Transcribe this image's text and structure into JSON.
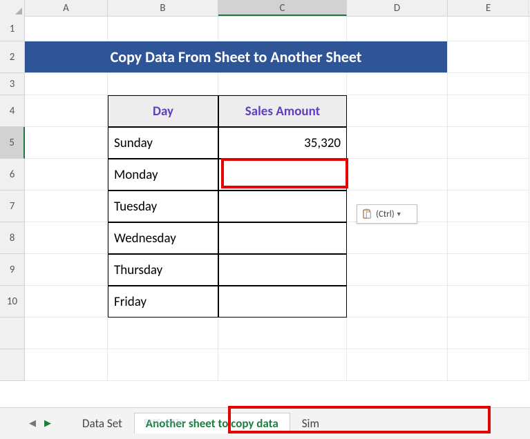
{
  "columns": {
    "A": "A",
    "B": "B",
    "C": "C",
    "D": "D",
    "E": "E"
  },
  "rows": {
    "r1": "1",
    "r2": "2",
    "r3": "3",
    "r4": "4",
    "r5": "5",
    "r6": "6",
    "r7": "7",
    "r8": "8",
    "r9": "9",
    "r10": "10"
  },
  "title": "Copy Data From Sheet to Another Sheet",
  "headers": {
    "day": "Day",
    "sales": "Sales Amount"
  },
  "data": {
    "days": [
      "Sunday",
      "Monday",
      "Tuesday",
      "Wednesday",
      "Thursday",
      "Friday"
    ],
    "sales": [
      "35,320",
      "",
      "",
      "",
      "",
      ""
    ]
  },
  "paste_popup": {
    "label": "(Ctrl)"
  },
  "tabs": {
    "t1": "Data Set",
    "t2": "Another sheet to copy data",
    "t3": "Sim"
  },
  "active_cell": "C5",
  "selected_row": 5,
  "selected_col": "C",
  "chart_data": {
    "type": "table",
    "title": "Copy Data From Sheet to Another Sheet",
    "columns": [
      "Day",
      "Sales Amount"
    ],
    "rows": [
      [
        "Sunday",
        35320
      ],
      [
        "Monday",
        null
      ],
      [
        "Tuesday",
        null
      ],
      [
        "Wednesday",
        null
      ],
      [
        "Thursday",
        null
      ],
      [
        "Friday",
        null
      ]
    ]
  }
}
